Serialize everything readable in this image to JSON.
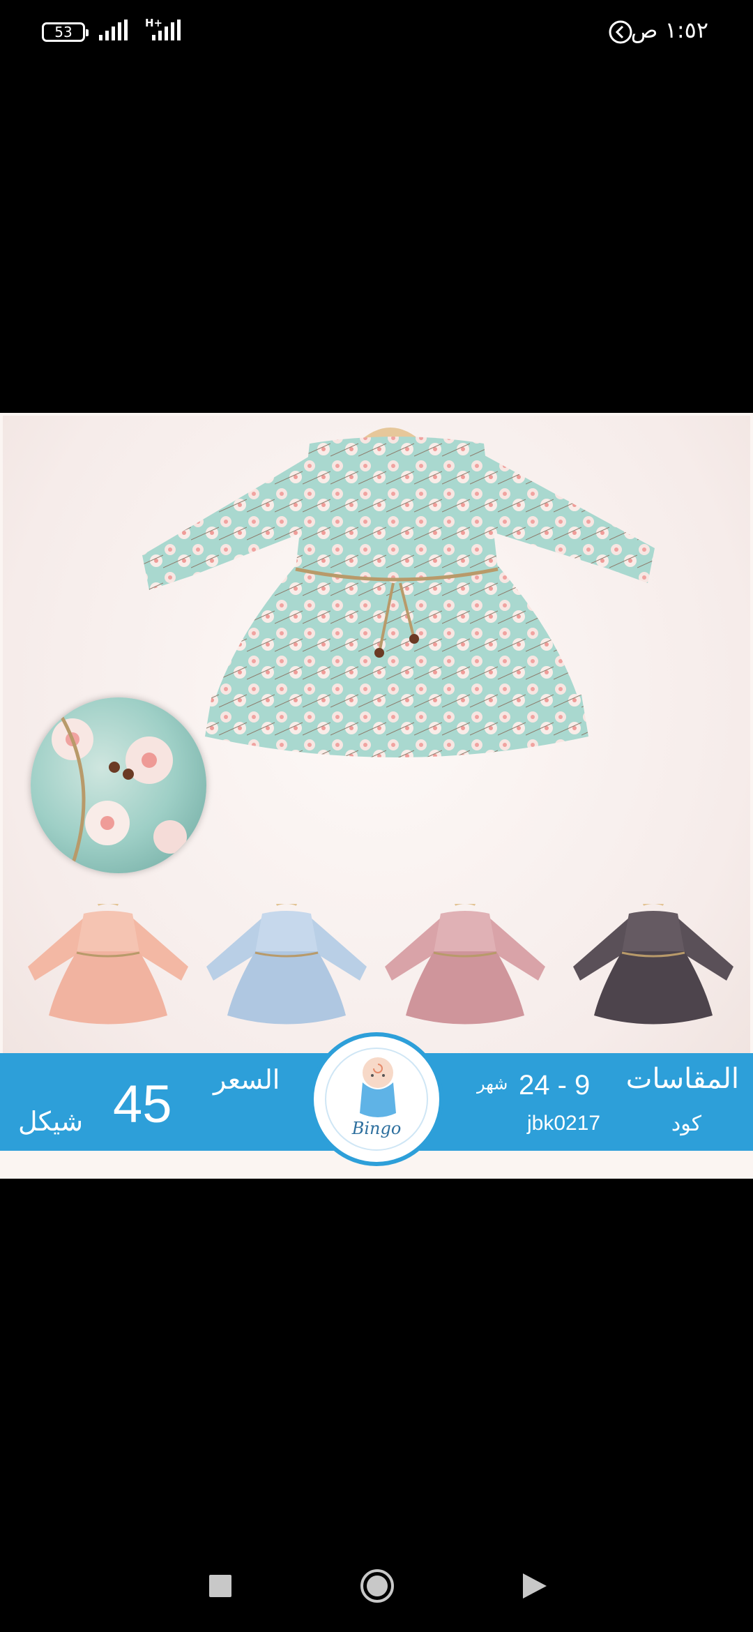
{
  "status_bar": {
    "battery": "53",
    "network": "H+",
    "time": "١:٥٢ ص"
  },
  "product": {
    "sizes_label": "المقاسات",
    "sizes_value": "24 - 9",
    "sizes_unit": "شهر",
    "code_label": "كود",
    "code_value": "jbk0217",
    "price_label": "السعر",
    "price_value": "45",
    "currency": "شيكل",
    "brand": "Bingo",
    "colors": {
      "banner": "#2d9fd9",
      "main_dress": "#a9d8cf",
      "variants": [
        "#f3b8a4",
        "#b9cfe6",
        "#d9a3a8",
        "#5a5058"
      ]
    }
  },
  "nav_bar": {
    "buttons": [
      "recents-icon",
      "home-icon",
      "back-icon"
    ]
  }
}
